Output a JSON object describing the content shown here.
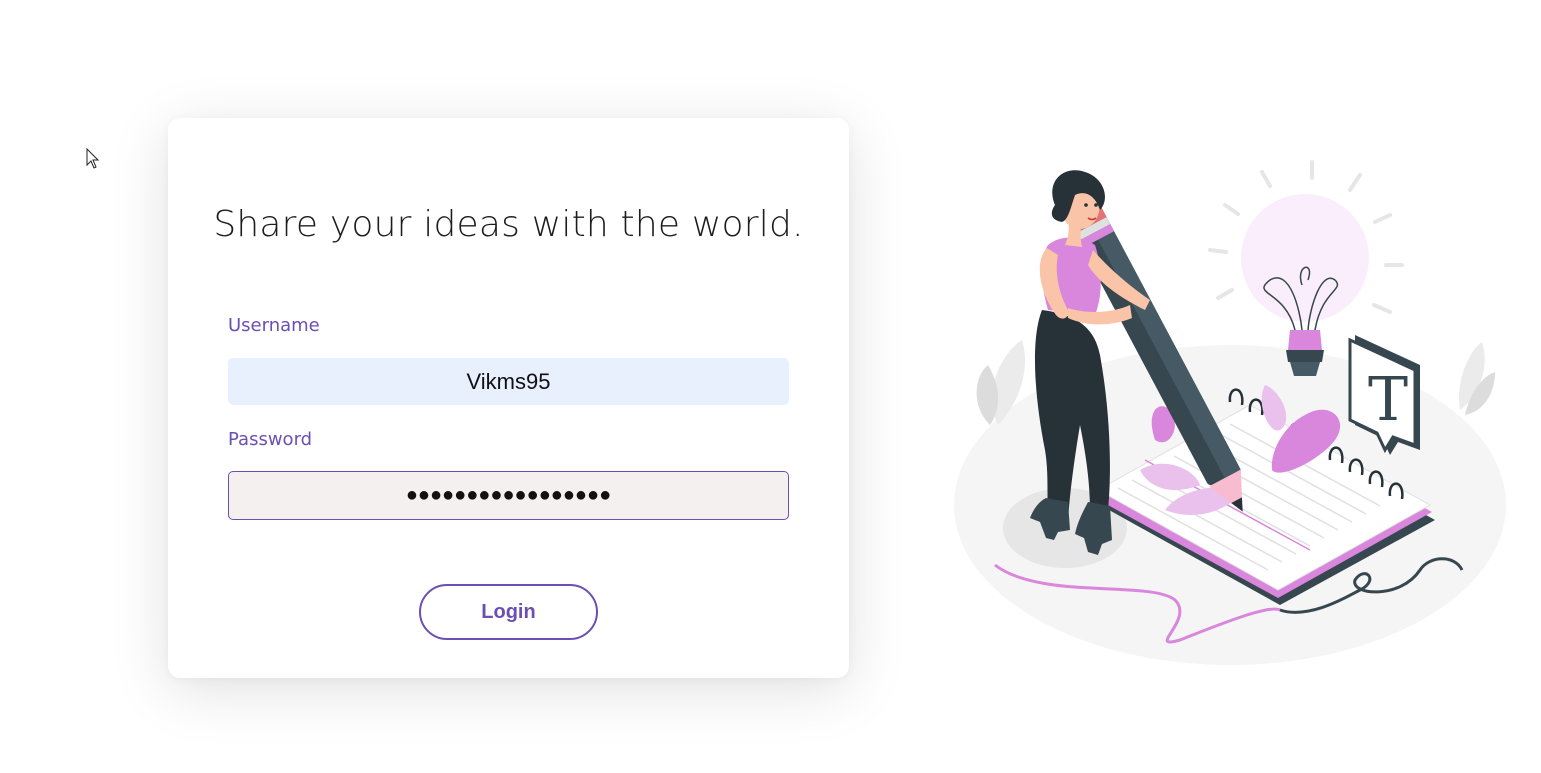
{
  "login": {
    "title": "Share your ideas with the world.",
    "username_label": "Username",
    "username_value": "Vikms95",
    "password_label": "Password",
    "password_value": "●●●●●●●●●●●●●●●●●",
    "login_button": "Login"
  },
  "illustration": {
    "icon": "writer-illustration",
    "badge_letter": "T"
  },
  "colors": {
    "accent": "#6c4fb3",
    "username_bg": "#e8f0fe",
    "password_bg": "#f3f0ef",
    "pink": "#d986dd",
    "dark": "#37474f"
  }
}
